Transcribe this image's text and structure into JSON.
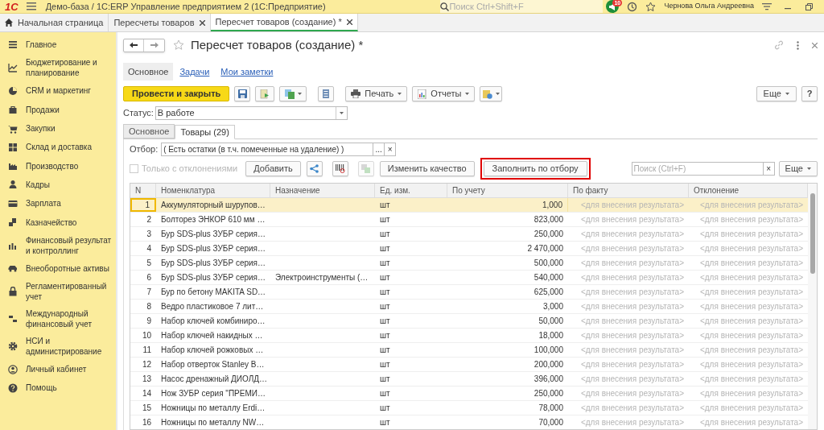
{
  "app_bar": {
    "logo": "1С",
    "title": "Демо-база / 1С:ERP Управление предприятием 2  (1С:Предприятие)",
    "search_placeholder": "Поиск Ctrl+Shift+F",
    "notification_count": "10",
    "user": "Чернова Ольга Андреевна"
  },
  "open_tabs": [
    {
      "label": "Начальная страница",
      "kind": "home",
      "selected": false
    },
    {
      "label": "Пересчеты товаров",
      "kind": "closable",
      "selected": false
    },
    {
      "label": "Пересчет товаров (создание) *",
      "kind": "closable",
      "selected": true
    }
  ],
  "sidebar": {
    "items": [
      {
        "label": "Главное"
      },
      {
        "label": "Бюджетирование и планирование"
      },
      {
        "label": "CRM и маркетинг"
      },
      {
        "label": "Продажи"
      },
      {
        "label": "Закупки"
      },
      {
        "label": "Склад и доставка"
      },
      {
        "label": "Производство"
      },
      {
        "label": "Кадры"
      },
      {
        "label": "Зарплата"
      },
      {
        "label": "Казначейство"
      },
      {
        "label": "Финансовый результат и контроллинг"
      },
      {
        "label": "Внеоборотные активы"
      },
      {
        "label": "Регламентированный учет"
      },
      {
        "label": "Международный финансовый учет"
      },
      {
        "label": "НСИ и администрирование"
      },
      {
        "label": "Личный кабинет"
      },
      {
        "label": "Помощь"
      }
    ]
  },
  "form": {
    "title": "Пересчет товаров (создание) *",
    "sections": [
      {
        "label": "Основное",
        "selected": true
      },
      {
        "label": "Задачи",
        "selected": false
      },
      {
        "label": "Мои заметки",
        "selected": false
      }
    ],
    "toolbar": {
      "primary": "Провести и закрыть",
      "print": "Печать",
      "reports": "Отчеты",
      "more": "Еще",
      "help": "?"
    },
    "status_label": "Статус:",
    "status_value": "В работе",
    "tabs": [
      {
        "label": "Основное",
        "selected": false
      },
      {
        "label": "Товары (29)",
        "selected": true
      }
    ],
    "filter_label": "Отбор:",
    "filter_value": "( Есть остатки (в т.ч. помеченные на удаление) )",
    "filter_choose": "...",
    "filter_clear": "×",
    "only_deviations": {
      "label": "Только с отклонениями",
      "checked": false,
      "disabled": true
    },
    "add_button": "Добавить",
    "change_quality_button": "Изменить качество",
    "fill_button": {
      "label": "Заполнить по отбору",
      "highlighted": true
    },
    "search_placeholder": "Поиск (Ctrl+F)",
    "search_clear": "×",
    "more_button": "Еще"
  },
  "table": {
    "columns": [
      "N",
      "Номенклатура",
      "Назначение",
      "Ед. изм.",
      "По учету",
      "По факту",
      "Отклонение"
    ],
    "rows": [
      {
        "n": "1",
        "name": "Аккумуляторный шурупов…",
        "purpose": "",
        "unit": "шт",
        "book": "1,000",
        "fact": "<для внесения результата>",
        "deviation": "<для внесения результата>",
        "selected": true
      },
      {
        "n": "2",
        "name": "Болторез ЭНКОР 610 мм …",
        "purpose": "",
        "unit": "шт",
        "book": "823,000",
        "fact": "<для внесения результата>",
        "deviation": "<для внесения результата>",
        "selected": false
      },
      {
        "n": "3",
        "name": "Бур SDS-plus ЗУБР серия…",
        "purpose": "",
        "unit": "шт",
        "book": "250,000",
        "fact": "<для внесения результата>",
        "deviation": "<для внесения результата>",
        "selected": false
      },
      {
        "n": "4",
        "name": "Бур SDS-plus ЗУБР серия…",
        "purpose": "",
        "unit": "шт",
        "book": "2 470,000",
        "fact": "<для внесения результата>",
        "deviation": "<для внесения результата>",
        "selected": false
      },
      {
        "n": "5",
        "name": "Бур SDS-plus ЗУБР серия…",
        "purpose": "",
        "unit": "шт",
        "book": "500,000",
        "fact": "<для внесения результата>",
        "deviation": "<для внесения результата>",
        "selected": false
      },
      {
        "n": "6",
        "name": "Бур SDS-plus ЗУБР серия…",
        "purpose": "Электроинструменты (…",
        "unit": "шт",
        "book": "540,000",
        "fact": "<для внесения результата>",
        "deviation": "<для внесения результата>",
        "selected": false
      },
      {
        "n": "7",
        "name": "Бур по бетону MAKITA SD…",
        "purpose": "",
        "unit": "шт",
        "book": "625,000",
        "fact": "<для внесения результата>",
        "deviation": "<для внесения результата>",
        "selected": false
      },
      {
        "n": "8",
        "name": "Ведро пластиковое 7 лит…",
        "purpose": "",
        "unit": "шт",
        "book": "3,000",
        "fact": "<для внесения результата>",
        "deviation": "<для внесения результата>",
        "selected": false
      },
      {
        "n": "9",
        "name": "Набор ключей комбиниро…",
        "purpose": "",
        "unit": "шт",
        "book": "50,000",
        "fact": "<для внесения результата>",
        "deviation": "<для внесения результата>",
        "selected": false
      },
      {
        "n": "10",
        "name": "Набор ключей накидных …",
        "purpose": "",
        "unit": "шт",
        "book": "18,000",
        "fact": "<для внесения результата>",
        "deviation": "<для внесения результата>",
        "selected": false
      },
      {
        "n": "11",
        "name": "Набор ключей рожковых …",
        "purpose": "",
        "unit": "шт",
        "book": "100,000",
        "fact": "<для внесения результата>",
        "deviation": "<для внесения результата>",
        "selected": false
      },
      {
        "n": "12",
        "name": "Набор отверток Stanley B…",
        "purpose": "",
        "unit": "шт",
        "book": "200,000",
        "fact": "<для внесения результата>",
        "deviation": "<для внесения результата>",
        "selected": false
      },
      {
        "n": "13",
        "name": "Насос дренажный ДИОЛД…",
        "purpose": "",
        "unit": "шт",
        "book": "396,000",
        "fact": "<для внесения результата>",
        "deviation": "<для внесения результата>",
        "selected": false
      },
      {
        "n": "14",
        "name": "Нож ЗУБР серия \"ПРЕМИ…",
        "purpose": "",
        "unit": "шт",
        "book": "250,000",
        "fact": "<для внесения результата>",
        "deviation": "<для внесения результата>",
        "selected": false
      },
      {
        "n": "15",
        "name": "Ножницы по металлу Erdi…",
        "purpose": "",
        "unit": "шт",
        "book": "78,000",
        "fact": "<для внесения результата>",
        "deviation": "<для внесения результата>",
        "selected": false
      },
      {
        "n": "16",
        "name": "Ножницы по металлу NW…",
        "purpose": "",
        "unit": "шт",
        "book": "70,000",
        "fact": "<для внесения результата>",
        "deviation": "<для внесения результата>",
        "selected": false
      }
    ]
  }
}
